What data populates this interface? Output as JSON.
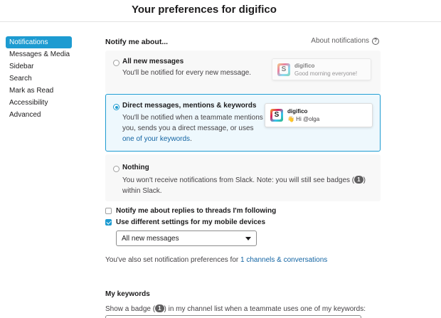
{
  "header": {
    "title": "Your preferences for digifico"
  },
  "sidebar": {
    "items": [
      {
        "label": "Notifications",
        "active": true
      },
      {
        "label": "Messages & Media"
      },
      {
        "label": "Sidebar"
      },
      {
        "label": "Search"
      },
      {
        "label": "Mark as Read"
      },
      {
        "label": "Accessibility"
      },
      {
        "label": "Advanced"
      }
    ]
  },
  "notify": {
    "heading": "Notify me about...",
    "about_link": "About notifications",
    "options": [
      {
        "title": "All new messages",
        "desc": "You'll be notified for every new message.",
        "selected": false,
        "preview": {
          "workspace": "digifico",
          "message": "Good morning everyone!"
        }
      },
      {
        "title": "Direct messages, mentions & keywords",
        "desc_line1": "You'll be notified when a teammate mentions",
        "desc_line2": "you, sends you a direct message, or uses",
        "desc_link": "one of your keywords",
        "desc_end": ".",
        "selected": true,
        "preview": {
          "workspace": "digifico",
          "message": "👋 Hi @olga"
        }
      },
      {
        "title": "Nothing",
        "desc_pre": "You won't receive notifications from Slack. Note: you will still see badges (",
        "badge": "1",
        "desc_post": ")",
        "desc_line2": "within Slack.",
        "selected": false
      }
    ]
  },
  "checkboxes": {
    "threads": {
      "label": "Notify me about replies to threads I'm following",
      "checked": false
    },
    "mobile": {
      "label": "Use different settings for my mobile devices",
      "checked": true
    }
  },
  "mobile_select": {
    "value": "All new messages"
  },
  "also": {
    "text": "You've also set notification preferences for ",
    "link": "1 channels & conversations"
  },
  "keywords": {
    "heading": "My keywords",
    "desc_pre": "Show a badge (",
    "badge": "1",
    "desc_post": ") in my channel list when a teammate uses one of my keywords:"
  },
  "colors": {
    "accent": "#1d9bd1",
    "link": "#1264a3",
    "selected_bg": "#eef8fd"
  }
}
